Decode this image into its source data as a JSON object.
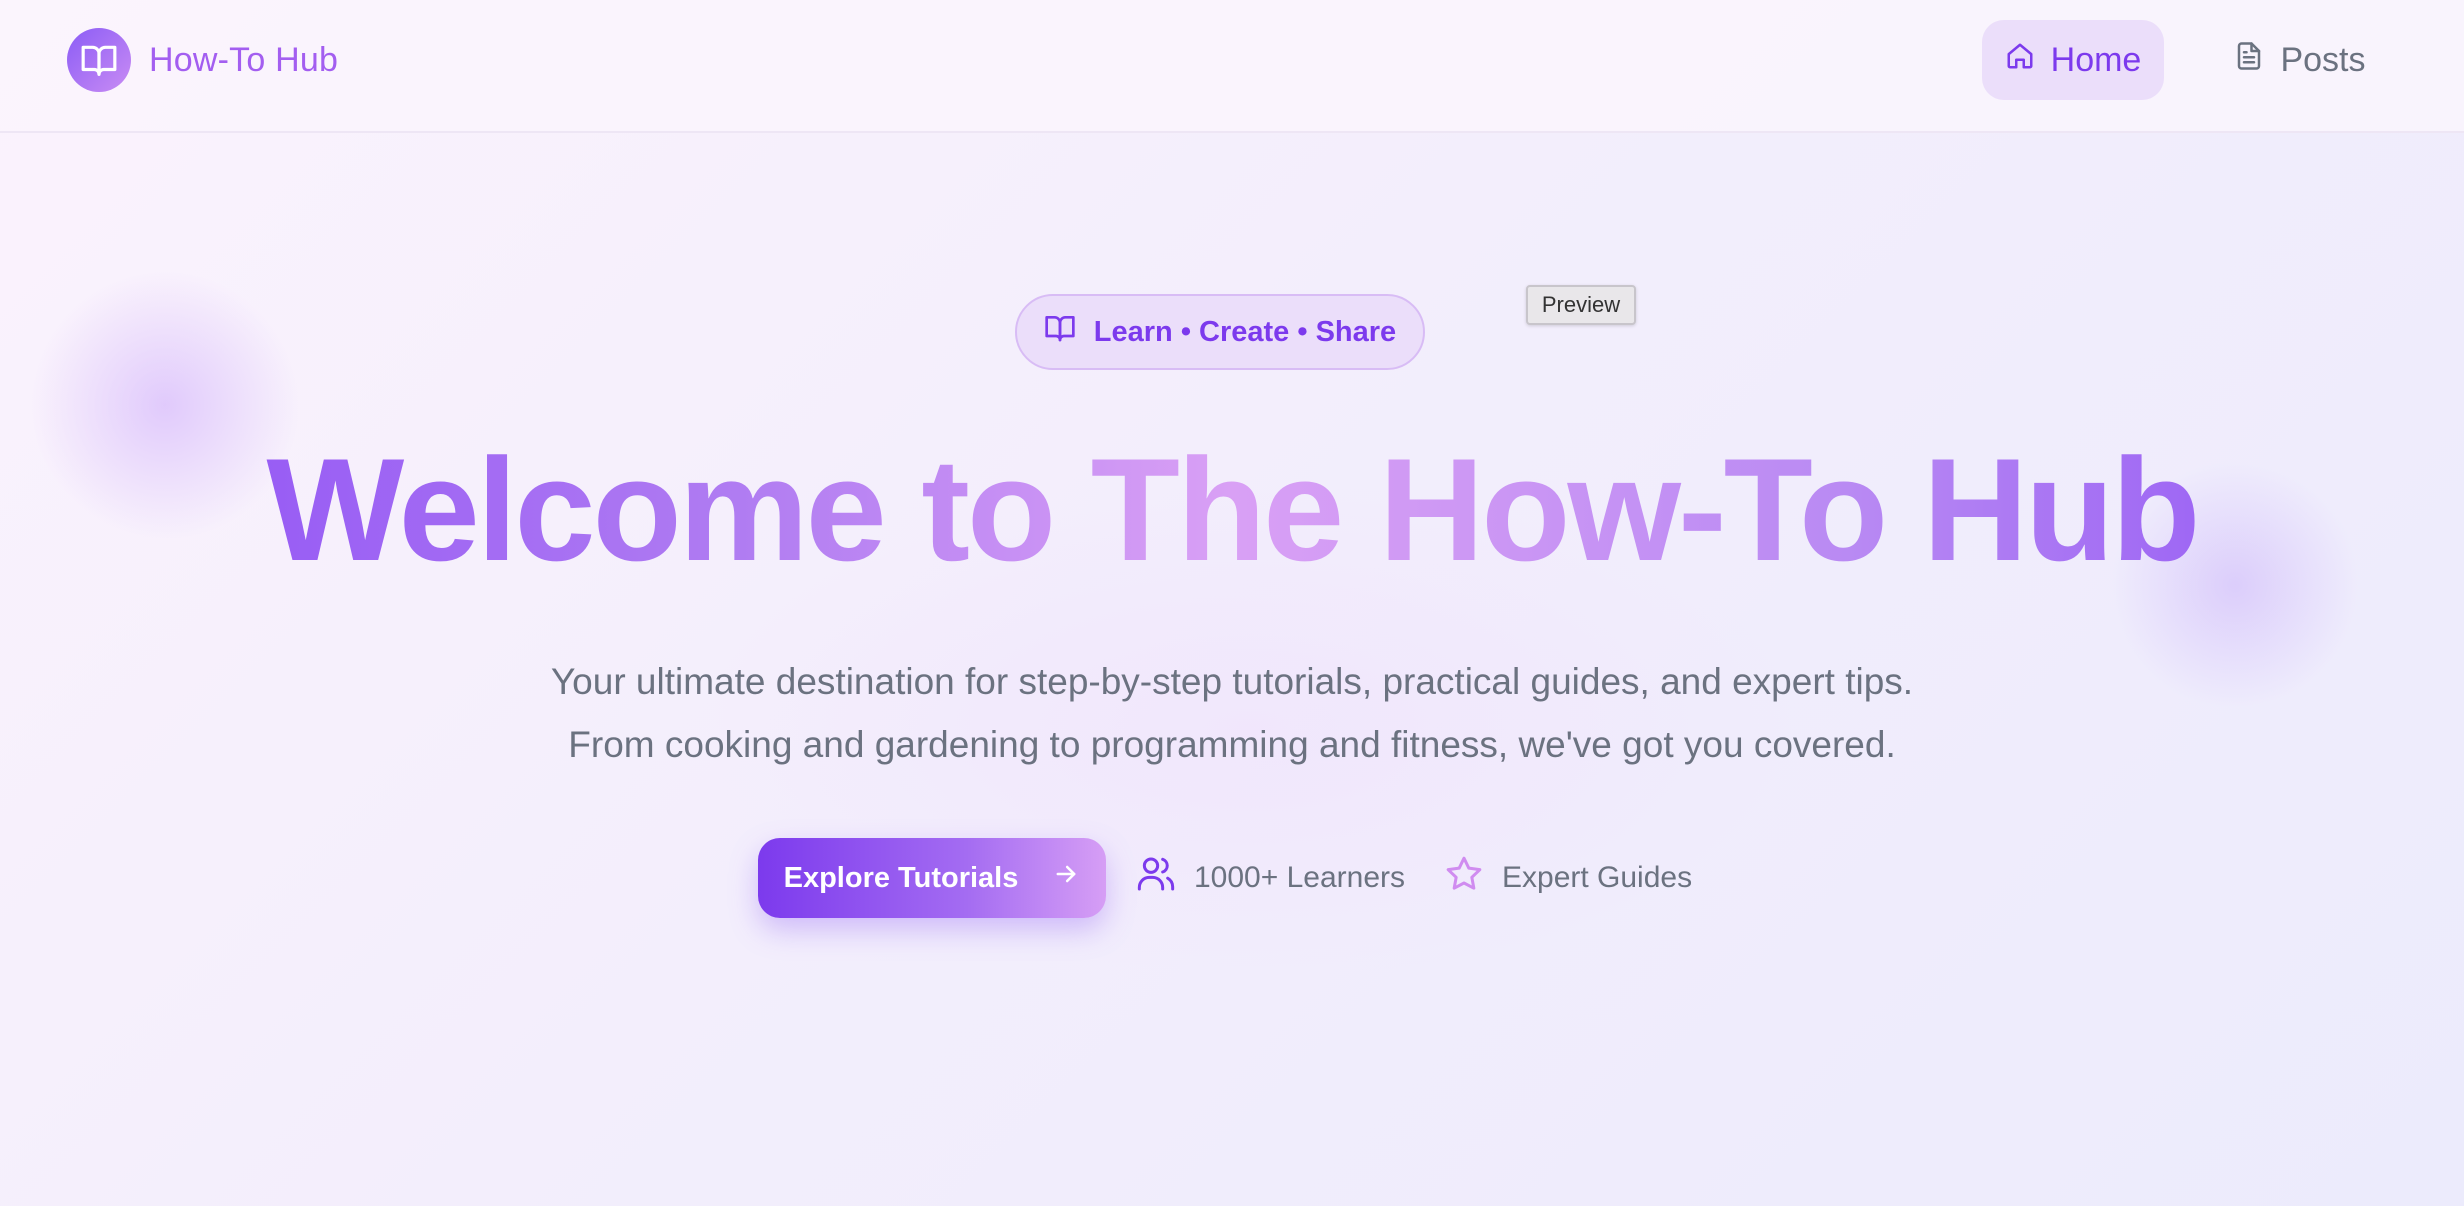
{
  "header": {
    "logo_text": "How-To Hub",
    "nav": {
      "home_label": "Home",
      "posts_label": "Posts"
    }
  },
  "preview_tag": "Preview",
  "hero": {
    "badge_text": "Learn • Create • Share",
    "title": "Welcome to The How-To Hub",
    "subtitle_line1": "Your ultimate destination for step-by-step tutorials, practical guides, and expert tips.",
    "subtitle_line2": "From cooking and gardening to programming and fitness, we've got you covered.",
    "cta_label": "Explore Tutorials",
    "stats": [
      {
        "icon": "users-icon",
        "label": "1000+ Learners"
      },
      {
        "icon": "star-icon",
        "label": "Expert Guides"
      }
    ]
  },
  "colors": {
    "accent": "#7c3aed",
    "accent_light": "#d69ef5",
    "text_muted": "#6b7280",
    "nav_active_bg": "#ebdefa"
  }
}
